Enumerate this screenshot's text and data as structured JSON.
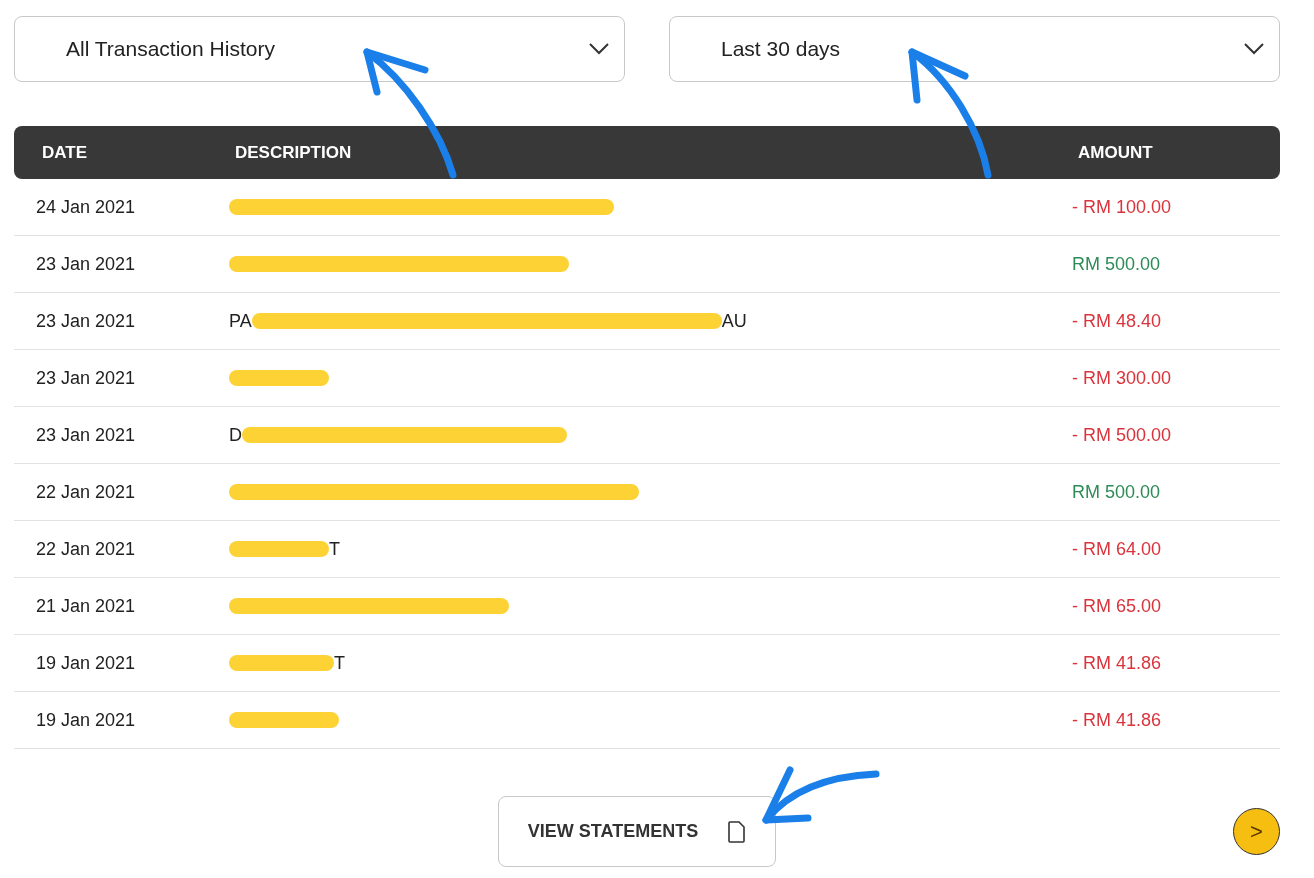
{
  "filters": [
    {
      "value": "All Transaction History"
    },
    {
      "value": "Last 30 days"
    }
  ],
  "table": {
    "columns": [
      "DATE",
      "DESCRIPTION",
      "AMOUNT"
    ],
    "rows": [
      {
        "date": "24 Jan 2021",
        "desc_start": "",
        "desc_end": "",
        "amount": "- RM 100.00",
        "kind": "debit"
      },
      {
        "date": "23 Jan 2021",
        "desc_start": "",
        "desc_end": "",
        "amount": "RM 500.00",
        "kind": "credit"
      },
      {
        "date": "23 Jan 2021",
        "desc_start": "PA",
        "desc_end": "AU",
        "amount": "- RM 48.40",
        "kind": "debit"
      },
      {
        "date": "23 Jan 2021",
        "desc_start": "",
        "desc_end": "",
        "amount": "- RM 300.00",
        "kind": "debit"
      },
      {
        "date": "23 Jan 2021",
        "desc_start": "D",
        "desc_end": "",
        "amount": "- RM 500.00",
        "kind": "debit"
      },
      {
        "date": "22 Jan 2021",
        "desc_start": "",
        "desc_end": "",
        "amount": "RM 500.00",
        "kind": "credit"
      },
      {
        "date": "22 Jan 2021",
        "desc_start": "",
        "desc_end": "T",
        "amount": "- RM 64.00",
        "kind": "debit"
      },
      {
        "date": "21 Jan 2021",
        "desc_start": "",
        "desc_end": "",
        "amount": "- RM 65.00",
        "kind": "debit"
      },
      {
        "date": "19 Jan 2021",
        "desc_start": "",
        "desc_end": "T",
        "amount": "- RM 41.86",
        "kind": "debit"
      },
      {
        "date": "19 Jan 2021",
        "desc_start": "",
        "desc_end": "",
        "amount": "- RM 41.86",
        "kind": "debit"
      }
    ]
  },
  "statements_button": {
    "label": "VIEW STATEMENTS"
  },
  "next_button": {
    "label": ">"
  }
}
